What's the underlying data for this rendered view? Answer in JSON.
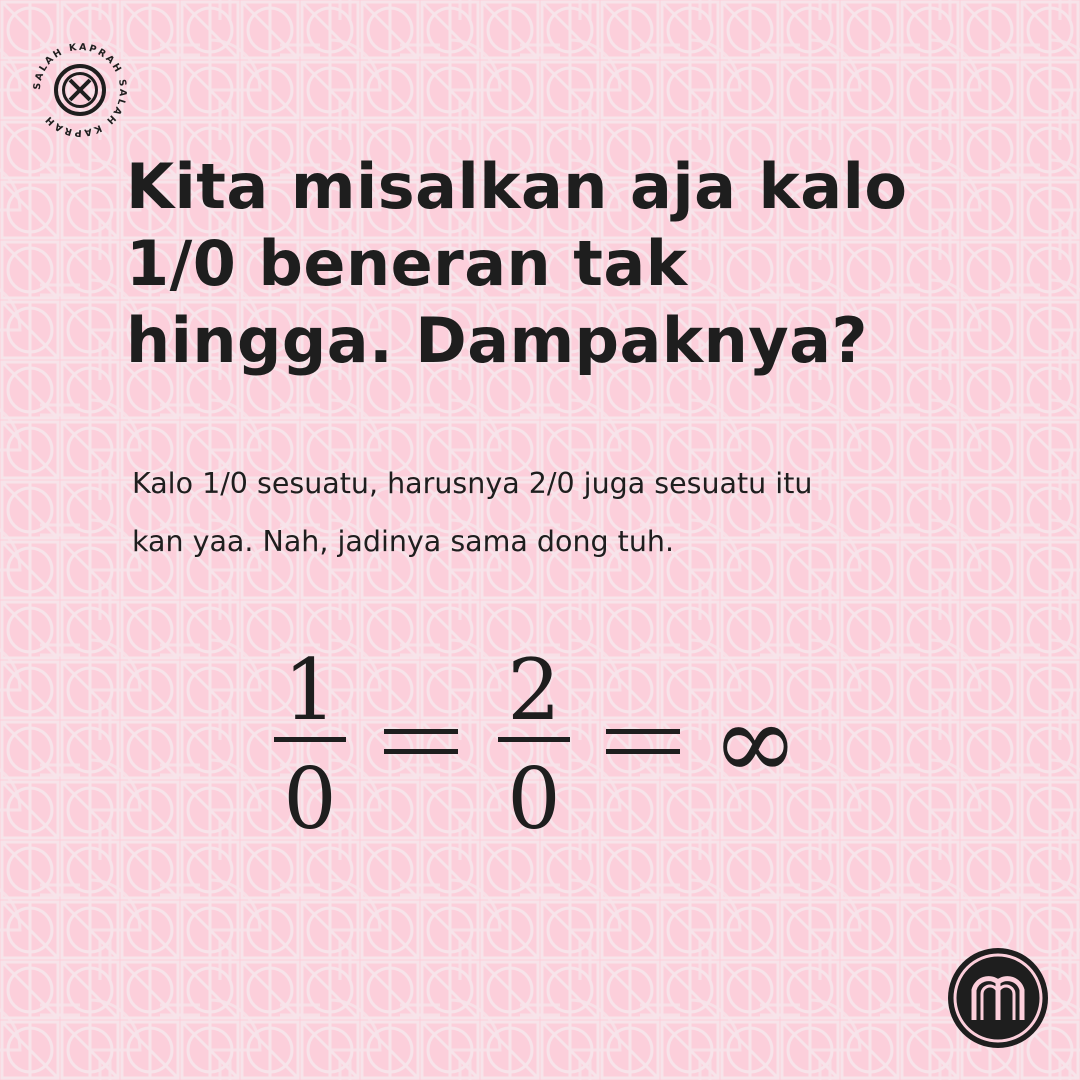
{
  "colors": {
    "background": "#fccfdb",
    "pattern": "#f7e4ea",
    "text": "#1e1e1e"
  },
  "badge": {
    "ring_text": "SALAH KAPRAH SALAH KAPRAH",
    "icon": "x-circle-icon"
  },
  "headline": {
    "lines": [
      "Kita misalkan aja kalo",
      "1/0 beneran tak",
      "hingga. Dampaknya?"
    ]
  },
  "body": {
    "lines": [
      "Kalo 1/0 sesuatu, harusnya 2/0 juga sesuatu itu",
      "kan yaa. Nah, jadinya sama dong tuh."
    ]
  },
  "equation": {
    "fraction1": {
      "numerator": "1",
      "denominator": "0"
    },
    "fraction2": {
      "numerator": "2",
      "denominator": "0"
    },
    "result": "∞"
  },
  "logo": {
    "icon": "m-monogram-icon"
  }
}
